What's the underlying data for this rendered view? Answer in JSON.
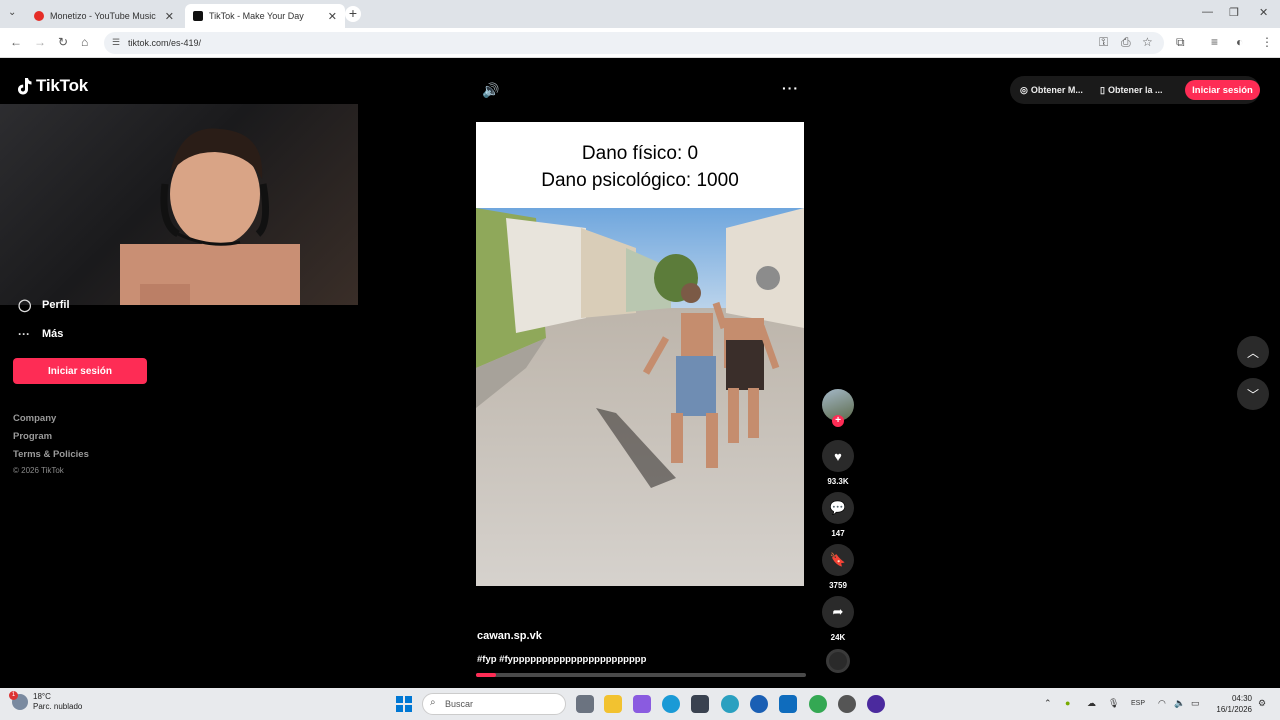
{
  "browser": {
    "tabs": [
      {
        "title": "Monetizo - YouTube Music"
      },
      {
        "title": "TikTok - Make Your Day"
      }
    ],
    "url": "tiktok.com/es-419/"
  },
  "sidebar": {
    "logo_text": "TikTok",
    "items": [
      {
        "label": "Perfil"
      },
      {
        "label": "Más"
      }
    ],
    "login_label": "Iniciar sesión",
    "footer_links": [
      "Company",
      "Program",
      "Terms & Policies"
    ],
    "copyright": "© 2026 TikTok"
  },
  "header": {
    "get_coins_label": "Obtener M...",
    "get_app_label": "Obtener la ...",
    "login_label": "Iniciar sesión"
  },
  "video": {
    "caption_line1": "Dano físico: 0",
    "caption_line2": "Dano psicológico: 1000",
    "username": "cawan.sp.vk",
    "hashtags": "#fyp #fyppppppppppppppppppppppp",
    "progress": 0.06
  },
  "actions": {
    "likes": "93.3K",
    "comments": "147",
    "saves": "3759",
    "shares": "24K"
  },
  "taskbar": {
    "temperature": "18°C",
    "weather": "Parc. nublado",
    "weather_badge": "1",
    "search_placeholder": "Buscar",
    "language": "ESP",
    "time": "04:30",
    "date": "16/1/2026"
  },
  "colors": {
    "accent": "#fe2c55",
    "background": "#000000"
  }
}
